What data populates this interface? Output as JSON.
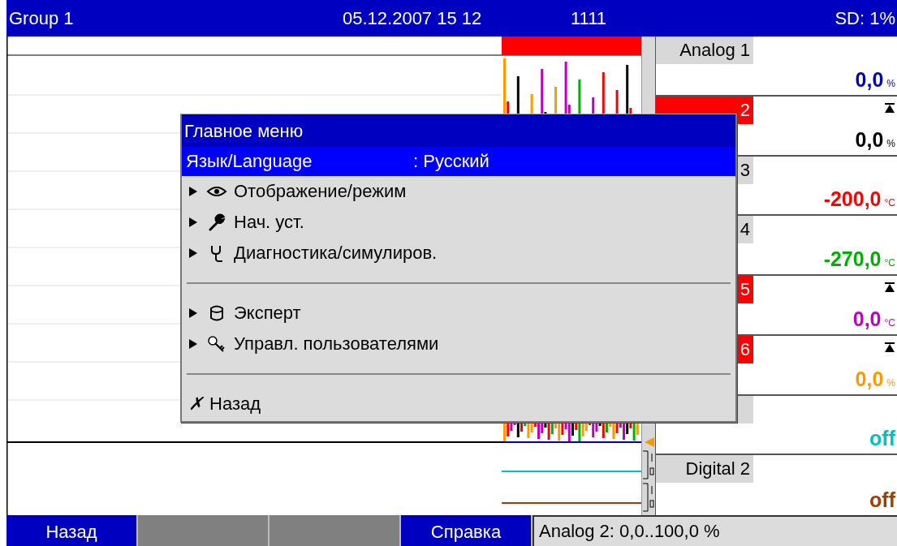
{
  "header": {
    "title": "Group 1",
    "datetime": "05.12.2007 15 12",
    "counter": "1111",
    "status": "SD: 1%"
  },
  "channels": [
    {
      "label": "Analog 1",
      "alarm": false,
      "value": "0,0",
      "unit": "%",
      "color": "#0000c0"
    },
    {
      "label": "2",
      "alarm": true,
      "value": "0,0",
      "unit": "%",
      "color": "#000000"
    },
    {
      "label": "3",
      "alarm": false,
      "value": "-200,0",
      "unit": "°C",
      "color": "#ff0000"
    },
    {
      "label": "4",
      "alarm": false,
      "value": "-270,0",
      "unit": "°C",
      "color": "#00b000"
    },
    {
      "label": "5",
      "alarm": true,
      "value": "0,0",
      "unit": "°C",
      "color": "#c000c0"
    },
    {
      "label": "6",
      "alarm": true,
      "value": "0,0",
      "unit": "%",
      "color": "#ff9900"
    },
    {
      "alarm": false,
      "value": "off",
      "color": "#00c0c0"
    },
    {
      "label": "Digital 2",
      "alarm": false,
      "value": "off",
      "color": "#a04000"
    }
  ],
  "menu": {
    "title": "Главное меню",
    "items": [
      {
        "kind": "setting",
        "label": "Язык/Language",
        "value": ": Русский",
        "selected": true
      },
      {
        "kind": "submenu",
        "label": "Отображение/режим",
        "selected": false
      },
      {
        "kind": "submenu",
        "label": "Нач. уст.",
        "selected": false
      },
      {
        "kind": "submenu",
        "label": "Диагностика/симулиров.",
        "selected": false
      },
      {
        "kind": "separator"
      },
      {
        "kind": "submenu",
        "label": "Эксперт",
        "selected": false
      },
      {
        "kind": "submenu",
        "label": "Управл. пользователями",
        "selected": false
      },
      {
        "kind": "separator"
      },
      {
        "kind": "back",
        "mark": "✗",
        "label": "Назад",
        "selected": false
      }
    ]
  },
  "softkeys": [
    {
      "kind": "button",
      "label": "Назад"
    },
    {
      "kind": "blank"
    },
    {
      "kind": "blank"
    },
    {
      "kind": "button",
      "label": "Справка"
    }
  ],
  "status_line": "Analog 2: 0,0..100,0 %"
}
